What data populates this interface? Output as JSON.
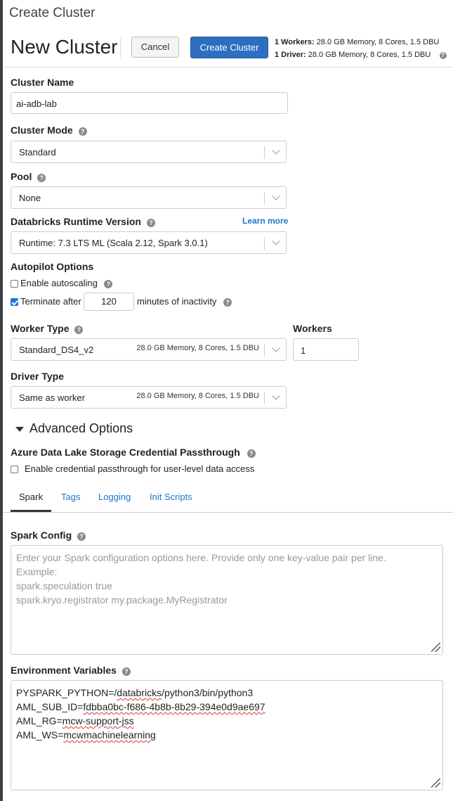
{
  "page_title": "Create Cluster",
  "header": {
    "title": "New Cluster",
    "cancel_label": "Cancel",
    "create_label": "Create Cluster",
    "workers_prefix": "1 Workers:",
    "workers_spec": "28.0 GB Memory, 8 Cores, 1.5 DBU",
    "driver_prefix": "1 Driver:",
    "driver_spec": "28.0 GB Memory, 8 Cores, 1.5 DBU"
  },
  "cluster_name": {
    "label": "Cluster Name",
    "value": "ai-adb-lab"
  },
  "cluster_mode": {
    "label": "Cluster Mode",
    "value": "Standard"
  },
  "pool": {
    "label": "Pool",
    "value": "None"
  },
  "runtime": {
    "label": "Databricks Runtime Version",
    "learn_more": "Learn more",
    "value": "Runtime: 7.3 LTS ML (Scala 2.12, Spark 3.0.1)"
  },
  "autopilot": {
    "label": "Autopilot Options",
    "autoscaling_label": "Enable autoscaling",
    "autoscaling_checked": false,
    "terminate_label": "Terminate after",
    "terminate_checked": true,
    "terminate_value": "120",
    "terminate_suffix": "minutes of inactivity"
  },
  "worker_type": {
    "label": "Worker Type",
    "value": "Standard_DS4_v2",
    "spec": "28.0 GB Memory, 8 Cores, 1.5 DBU"
  },
  "workers": {
    "label": "Workers",
    "value": "1"
  },
  "driver_type": {
    "label": "Driver Type",
    "value": "Same as worker",
    "spec": "28.0 GB Memory, 8 Cores, 1.5 DBU"
  },
  "advanced": {
    "label": "Advanced Options",
    "passthrough_label": "Azure Data Lake Storage Credential Passthrough",
    "passthrough_checkbox_label": "Enable credential passthrough for user-level data access",
    "passthrough_checked": false,
    "tabs": [
      "Spark",
      "Tags",
      "Logging",
      "Init Scripts"
    ],
    "active_tab": "Spark"
  },
  "spark_config": {
    "label": "Spark Config",
    "placeholder_lines": [
      "Enter your Spark configuration options here. Provide only one key-value pair per line.",
      "Example:",
      "spark.speculation true",
      "spark.kryo.registrator my.package.MyRegistrator"
    ]
  },
  "env_vars": {
    "label": "Environment Variables",
    "lines": [
      {
        "key": "PYSPARK_PYTHON=/",
        "spell": "databricks",
        "rest": "/python3/bin/python3"
      },
      {
        "key": "AML_SUB_ID=",
        "spell": "fdbba0bc-f686-4b8b-8b29-394e0d9ae697",
        "rest": ""
      },
      {
        "key": "AML_RG=",
        "spell": "mcw-support-jss",
        "rest": ""
      },
      {
        "key": "AML_WS=",
        "spell": "mcwmachinelearning",
        "rest": ""
      }
    ]
  },
  "colors": {
    "primary": "#2c6fc1",
    "link": "#1f74c8",
    "border": "#cccccc"
  }
}
